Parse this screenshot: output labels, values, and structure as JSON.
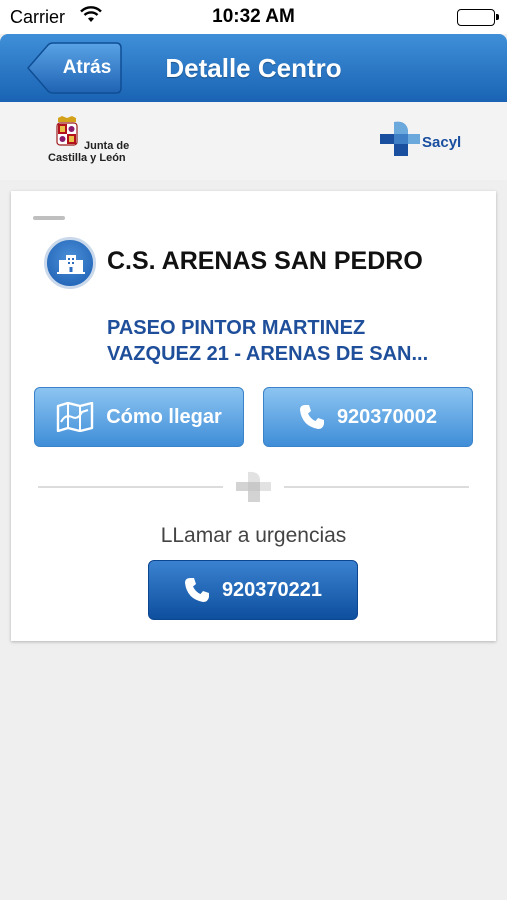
{
  "status_bar": {
    "carrier": "Carrier",
    "time": "10:32 AM",
    "wifi_icon": "wifi-icon",
    "battery_icon": "battery-icon"
  },
  "nav": {
    "back_label": "Atrás",
    "title": "Detalle Centro"
  },
  "logos": {
    "left": {
      "line1": "Junta de",
      "line2": "Castilla y León"
    },
    "right": {
      "name": "Sacyl"
    }
  },
  "center": {
    "icon": "building-icon",
    "name": "C.S. ARENAS SAN PEDRO",
    "address_line1": "PASEO PINTOR MARTINEZ",
    "address_line2": "VAZQUEZ 21 - ARENAS DE SAN..."
  },
  "actions": {
    "route_label": "Cómo llegar",
    "route_icon": "map-icon",
    "phone_number": "920370002",
    "phone_icon": "phone-icon"
  },
  "urgent": {
    "label": "LLamar a urgencias",
    "phone_number": "920370221"
  },
  "colors": {
    "nav_blue": "#1a63b4",
    "address_blue": "#1f4f9a",
    "button_light": "#5aa6e6",
    "button_dark": "#0e4f9e"
  }
}
